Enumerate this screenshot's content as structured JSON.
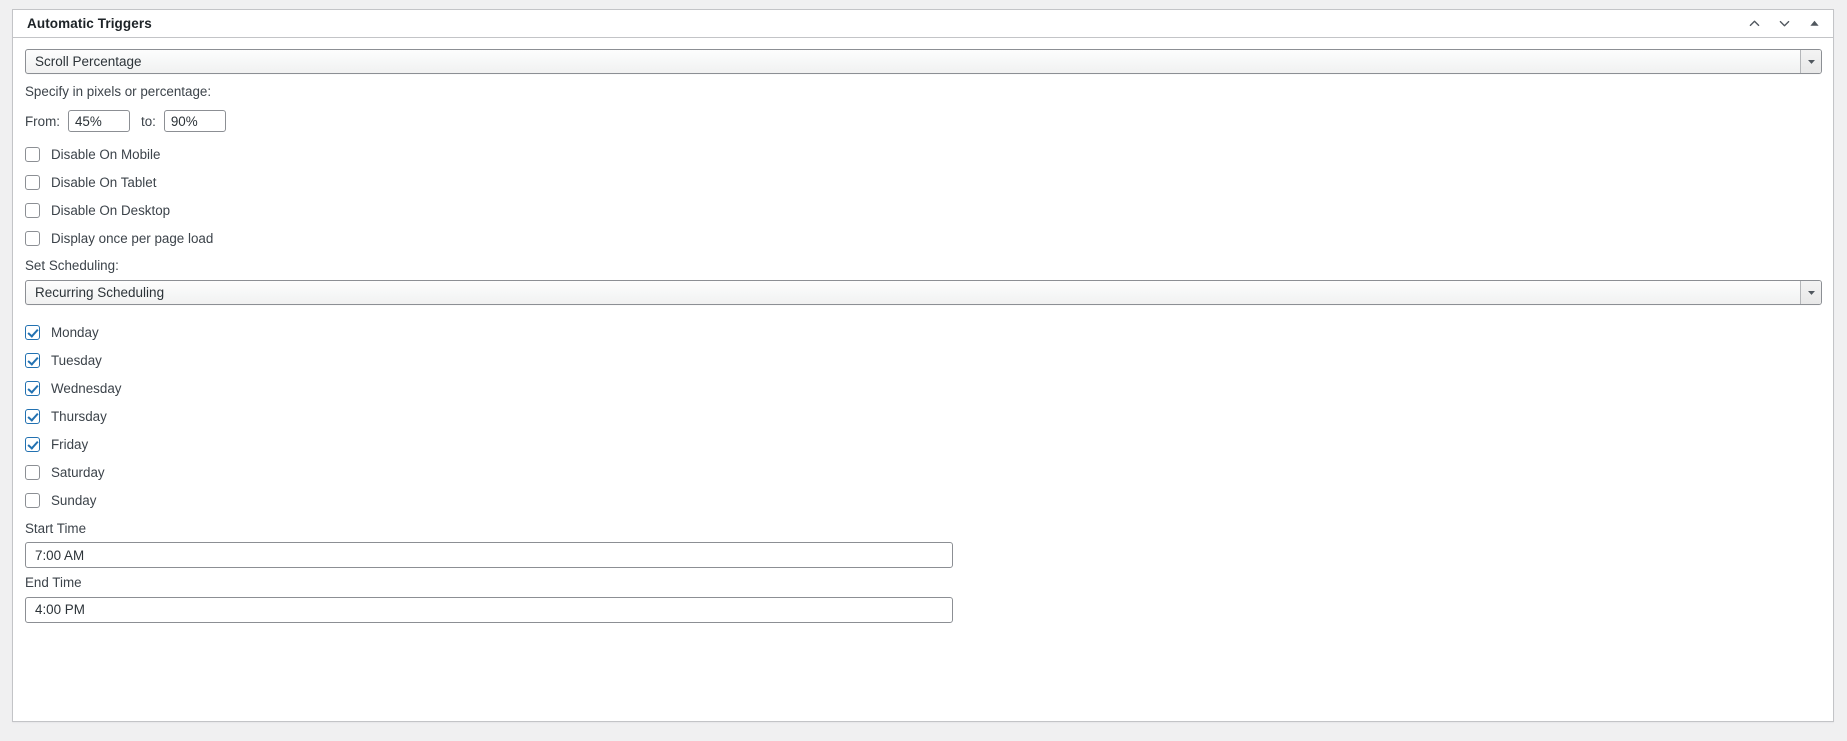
{
  "panel": {
    "title": "Automatic Triggers",
    "header_actions": [
      {
        "name": "move-up-button",
        "icon": "chevron-up-icon",
        "label": ""
      },
      {
        "name": "move-down-button",
        "icon": "chevron-down-icon",
        "label": ""
      },
      {
        "name": "toggle-panel-button",
        "icon": "triangle-up-icon",
        "label": ""
      }
    ]
  },
  "trigger_select": {
    "value": "Scroll Percentage",
    "arrow_icon": "caret-down-icon"
  },
  "range": {
    "instruction": "Specify in pixels or percentage:",
    "from_label": "From:",
    "from_value": "45%",
    "to_label": "to:",
    "to_value": "90%"
  },
  "device_options": [
    {
      "label": "Disable On Mobile",
      "checked": false
    },
    {
      "label": "Disable On Tablet",
      "checked": false
    },
    {
      "label": "Disable On Desktop",
      "checked": false
    },
    {
      "label": "Display once per page load",
      "checked": false
    }
  ],
  "scheduling": {
    "label": "Set Scheduling:",
    "value": "Recurring Scheduling",
    "arrow_icon": "caret-down-icon"
  },
  "days": [
    {
      "label": "Monday",
      "checked": true
    },
    {
      "label": "Tuesday",
      "checked": true
    },
    {
      "label": "Wednesday",
      "checked": true
    },
    {
      "label": "Thursday",
      "checked": true
    },
    {
      "label": "Friday",
      "checked": true
    },
    {
      "label": "Saturday",
      "checked": false
    },
    {
      "label": "Sunday",
      "checked": false
    }
  ],
  "start_time": {
    "label": "Start Time",
    "value": "7:00 AM"
  },
  "end_time": {
    "label": "End Time",
    "value": "4:00 PM"
  },
  "colors": {
    "accent": "#2271b1",
    "panel_border": "#c3c4c7",
    "text": "#3c434a",
    "heading": "#1d2327",
    "page_background": "#f0f0f1"
  }
}
